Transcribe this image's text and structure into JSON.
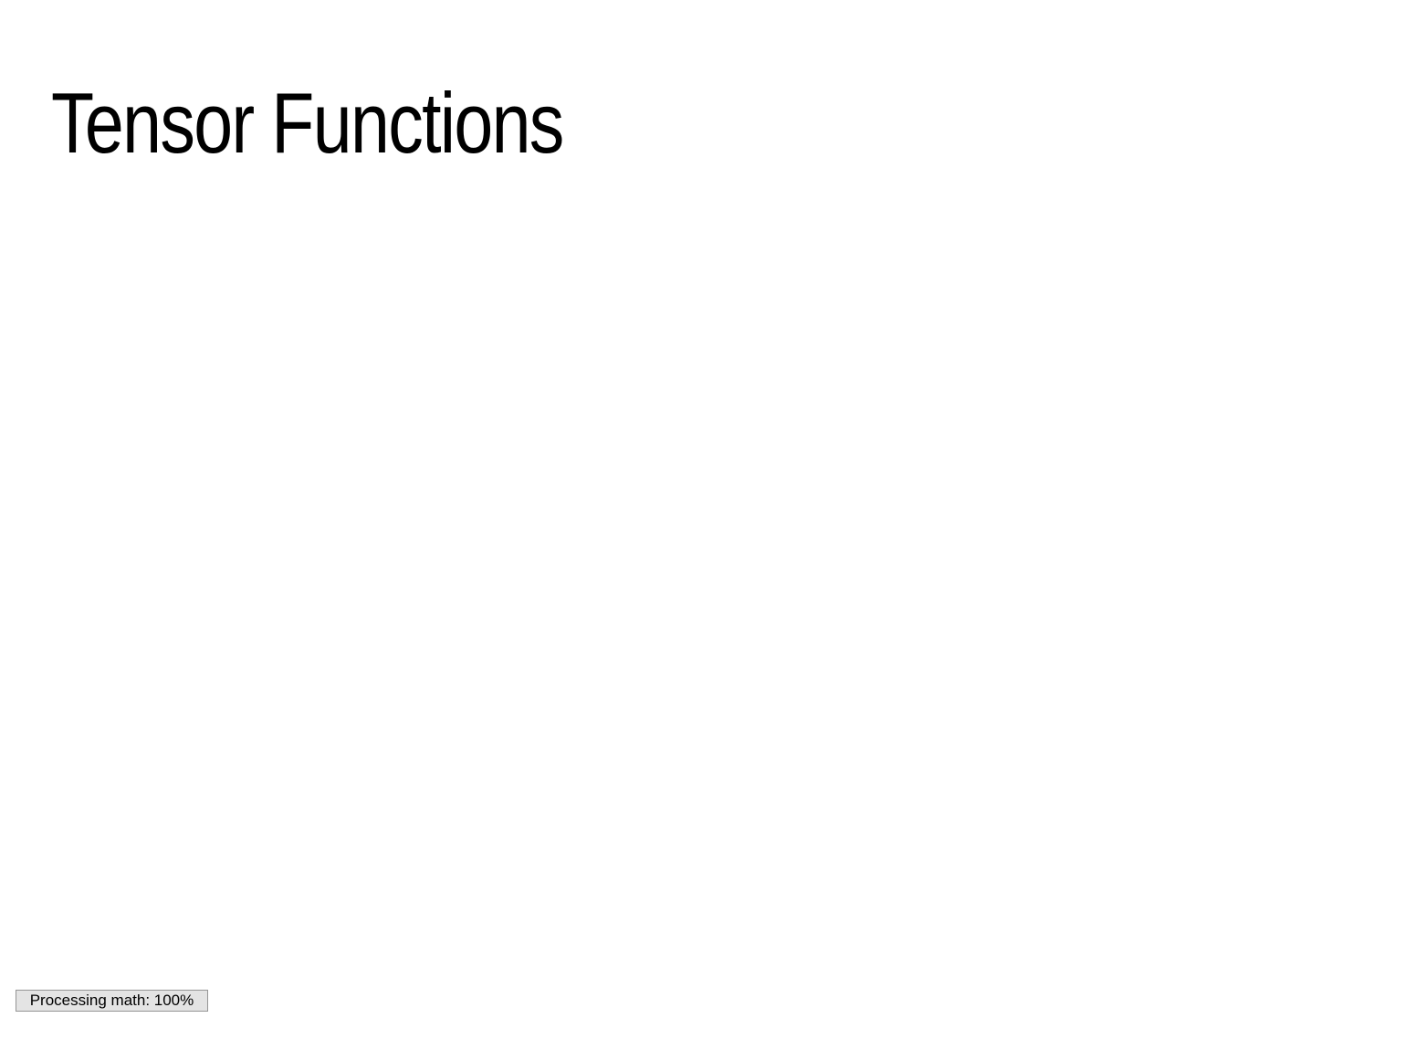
{
  "page": {
    "title": "Tensor Functions"
  },
  "status": {
    "message": "Processing math: 100%",
    "progress_percent": 100
  },
  "colors": {
    "background": "#ffffff",
    "title_text": "#000000",
    "status_background": "#e4e4e4",
    "status_border": "#959595"
  }
}
